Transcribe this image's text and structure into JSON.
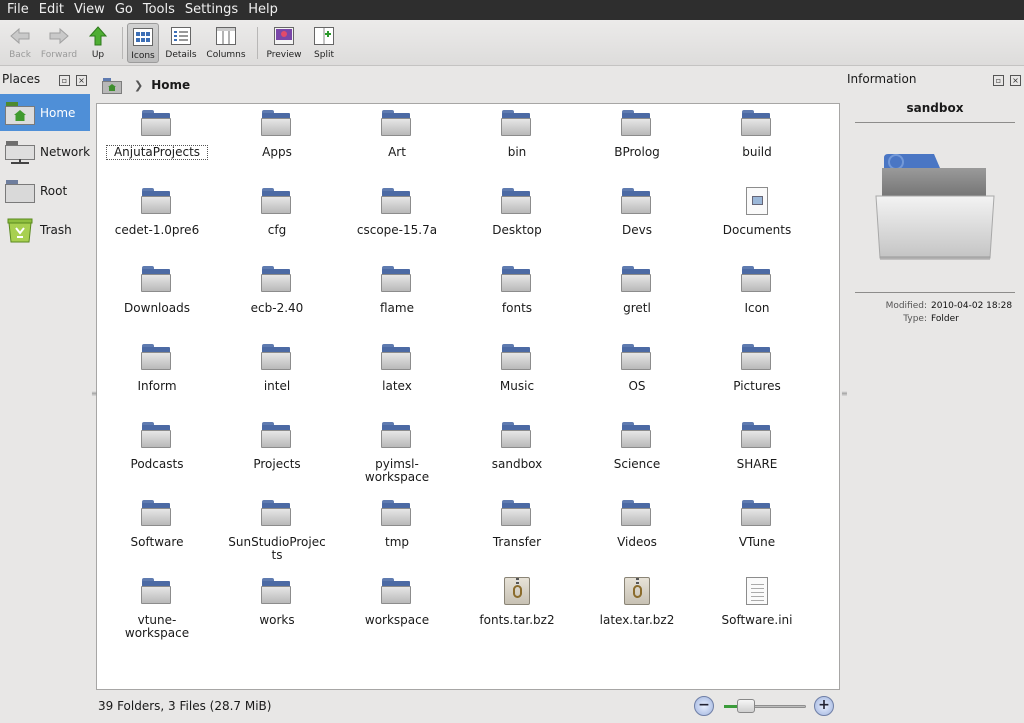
{
  "menu": [
    "File",
    "Edit",
    "View",
    "Go",
    "Tools",
    "Settings",
    "Help"
  ],
  "toolbar": {
    "back": "Back",
    "forward": "Forward",
    "up": "Up",
    "icons": "Icons",
    "details": "Details",
    "columns": "Columns",
    "preview": "Preview",
    "split": "Split"
  },
  "places": {
    "title": "Places",
    "items": [
      {
        "label": "Home",
        "icon": "home-folder-icon"
      },
      {
        "label": "Network",
        "icon": "network-icon"
      },
      {
        "label": "Root",
        "icon": "drive-icon"
      },
      {
        "label": "Trash",
        "icon": "trash-icon"
      }
    ]
  },
  "breadcrumb": {
    "current": "Home"
  },
  "files": [
    {
      "name": "AnjutaProjects",
      "type": "folder"
    },
    {
      "name": "Apps",
      "type": "folder"
    },
    {
      "name": "Art",
      "type": "folder"
    },
    {
      "name": "bin",
      "type": "folder"
    },
    {
      "name": "BProlog",
      "type": "folder"
    },
    {
      "name": "build",
      "type": "folder"
    },
    {
      "name": "cedet-1.0pre6",
      "type": "folder"
    },
    {
      "name": "cfg",
      "type": "folder"
    },
    {
      "name": "cscope-15.7a",
      "type": "folder"
    },
    {
      "name": "Desktop",
      "type": "folder"
    },
    {
      "name": "Devs",
      "type": "folder"
    },
    {
      "name": "Documents",
      "type": "document"
    },
    {
      "name": "Downloads",
      "type": "folder"
    },
    {
      "name": "ecb-2.40",
      "type": "folder"
    },
    {
      "name": "flame",
      "type": "folder"
    },
    {
      "name": "fonts",
      "type": "folder"
    },
    {
      "name": "gretl",
      "type": "folder"
    },
    {
      "name": "Icon",
      "type": "folder"
    },
    {
      "name": "Inform",
      "type": "folder"
    },
    {
      "name": "intel",
      "type": "folder"
    },
    {
      "name": "latex",
      "type": "folder"
    },
    {
      "name": "Music",
      "type": "folder"
    },
    {
      "name": "OS",
      "type": "folder"
    },
    {
      "name": "Pictures",
      "type": "folder"
    },
    {
      "name": "Podcasts",
      "type": "folder"
    },
    {
      "name": "Projects",
      "type": "folder"
    },
    {
      "name": "pyimsl-workspace",
      "type": "folder"
    },
    {
      "name": "sandbox",
      "type": "folder"
    },
    {
      "name": "Science",
      "type": "folder"
    },
    {
      "name": "SHARE",
      "type": "folder"
    },
    {
      "name": "Software",
      "type": "folder"
    },
    {
      "name": "SunStudioProjects",
      "type": "folder"
    },
    {
      "name": "tmp",
      "type": "folder"
    },
    {
      "name": "Transfer",
      "type": "folder"
    },
    {
      "name": "Videos",
      "type": "folder"
    },
    {
      "name": "VTune",
      "type": "folder"
    },
    {
      "name": "vtune-workspace",
      "type": "folder"
    },
    {
      "name": "works",
      "type": "folder"
    },
    {
      "name": "workspace",
      "type": "folder"
    },
    {
      "name": "fonts.tar.bz2",
      "type": "archive"
    },
    {
      "name": "latex.tar.bz2",
      "type": "archive"
    },
    {
      "name": "Software.ini",
      "type": "text"
    }
  ],
  "info": {
    "title": "Information",
    "name": "sandbox",
    "modified_label": "Modified:",
    "modified_value": "2010-04-02 18:28",
    "type_label": "Type:",
    "type_value": "Folder"
  },
  "status": {
    "text": "39 Folders, 3 Files (28.7 MiB)",
    "zoom_level": 0.2
  }
}
